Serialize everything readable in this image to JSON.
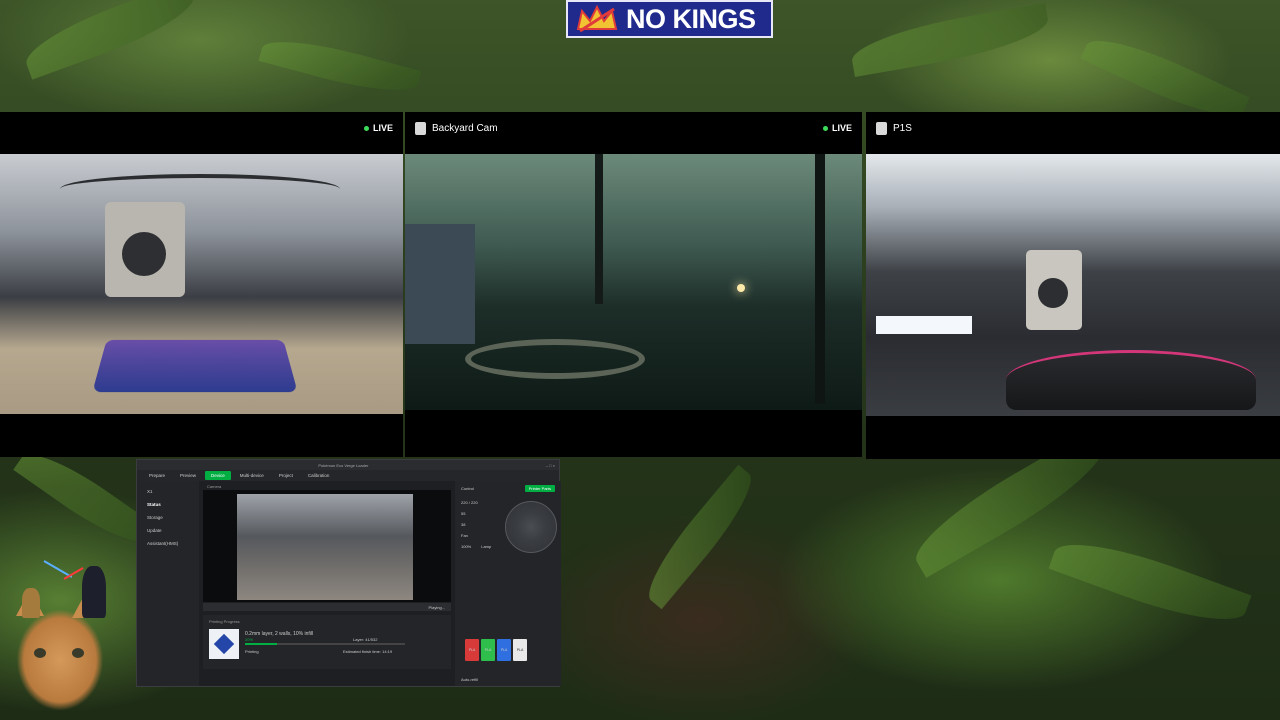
{
  "banner": {
    "text": "NO KINGS"
  },
  "cameras": [
    {
      "title": "",
      "live": "LIVE"
    },
    {
      "title": "Backyard Cam",
      "live": "LIVE"
    },
    {
      "title": "P1S",
      "live": ""
    }
  ],
  "app": {
    "title": "Pokémon Eco Verge Loader",
    "tabs": [
      "Prepare",
      "Preview",
      "Device",
      "Multi-device",
      "Project",
      "Calibration"
    ],
    "active_tab": "Device",
    "printer": "X1",
    "sidebar": [
      "Status",
      "Storage",
      "Update",
      "Assistant(HMS)"
    ],
    "camera_label": "Camera",
    "video_status": "Playing...",
    "progress": {
      "title": "Printing Progress",
      "job": "0.2mm layer, 2 walls, 10% infill",
      "percent": 0.2,
      "status": "Printing",
      "layer": "Layer: 41/532",
      "estimate": "Estimated finish time: 14:19",
      "percent_label": "20%"
    },
    "control": {
      "title": "Control",
      "button": "Printer Parts",
      "nozzle_temp": "220 / 220",
      "bed_temp": "55",
      "chamber_temp": "38",
      "fan_label": "Fan",
      "speed": "100%",
      "lamp": "Lamp",
      "auto_refill": "Auto-refill"
    },
    "ams": [
      {
        "label": "PLA",
        "color": "#d83a3a"
      },
      {
        "label": "PLA",
        "color": "#2fbe4b"
      },
      {
        "label": "PLA",
        "color": "#2f6fe0"
      },
      {
        "label": "PLA",
        "color": "#e9e9e9"
      }
    ]
  },
  "colors": {
    "accent_green": "#00ae42",
    "banner_blue": "#1f2a8c",
    "live_green": "#3ddc58"
  },
  "icons": [
    "crown-icon",
    "camera-icon",
    "live-dot-icon",
    "cat-avatar",
    "figurine"
  ]
}
